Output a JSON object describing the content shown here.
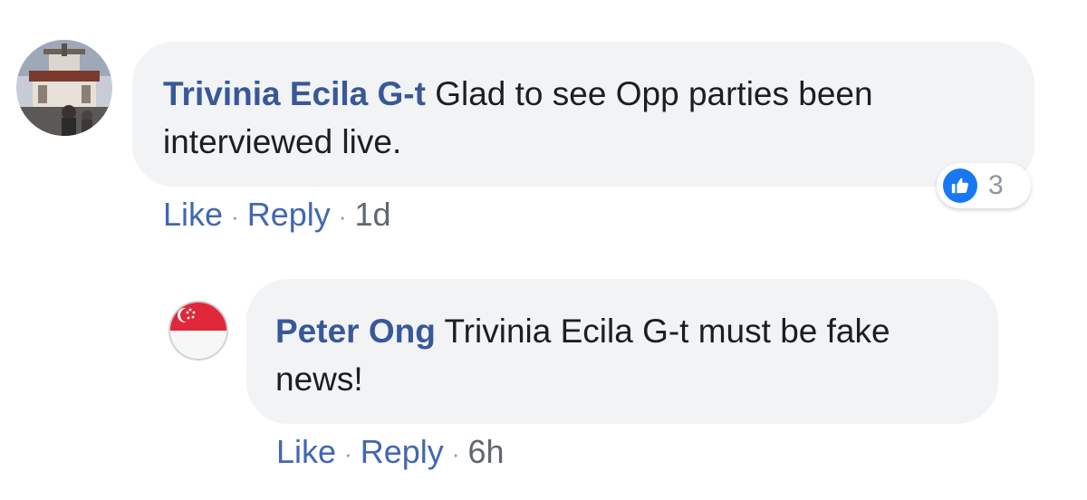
{
  "comments": [
    {
      "author": "Trivinia Ecila G-t",
      "text": "Glad to see Opp parties been interviewed live.",
      "actions": {
        "like": "Like",
        "reply": "Reply",
        "separator": "·",
        "time": "1d"
      },
      "reactions": {
        "icon": "like-icon",
        "count": "3",
        "color": "#1877f2"
      }
    },
    {
      "author": "Peter Ong",
      "text": "Trivinia Ecila G-t must be fake news!",
      "actions": {
        "like": "Like",
        "reply": "Reply",
        "separator": "·",
        "time": "6h"
      }
    }
  ],
  "colors": {
    "author": "#385898",
    "link": "#4267b2",
    "bubble": "#f2f3f5",
    "muted": "#606770"
  }
}
